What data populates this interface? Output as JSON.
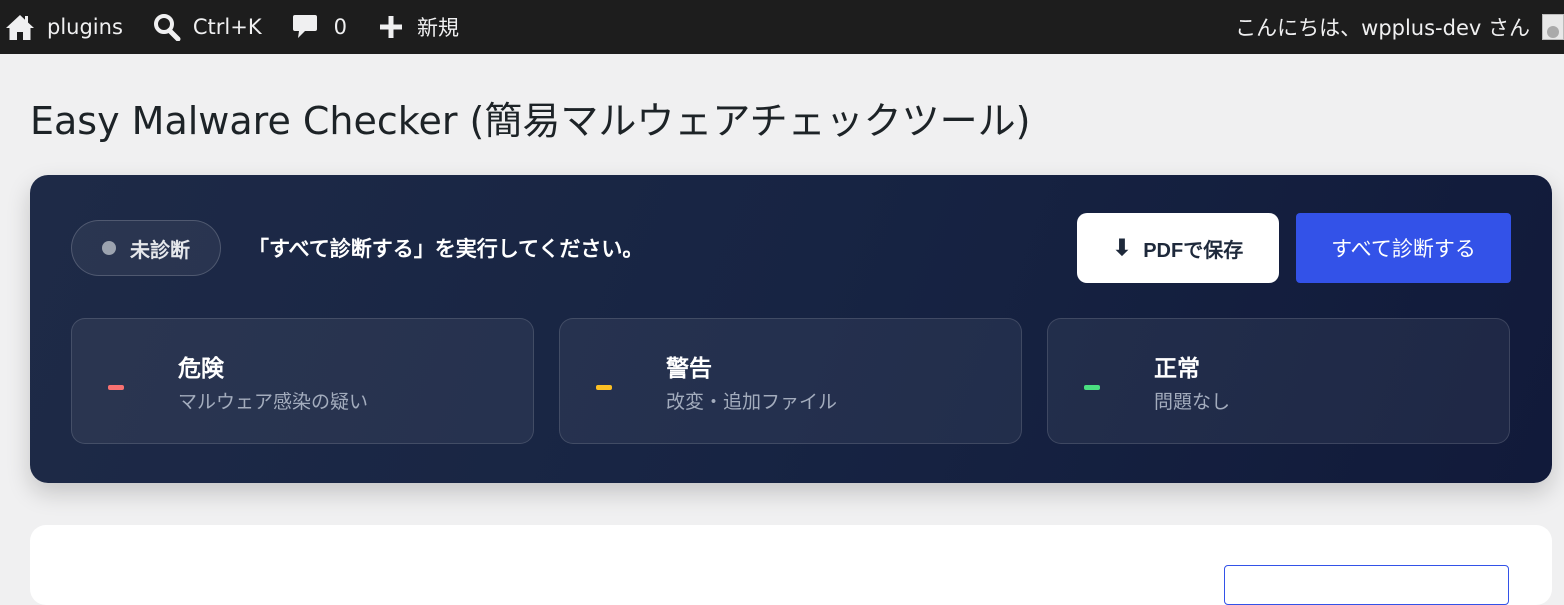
{
  "adminbar": {
    "site_name": "plugins",
    "search_shortcut": "Ctrl+K",
    "comments_count": "0",
    "new_label": "新規",
    "greeting": "こんにちは、wpplus-dev さん"
  },
  "page": {
    "title": "Easy Malware Checker (簡易マルウェアチェックツール)"
  },
  "panel": {
    "status_label": "未診断",
    "status_message": "「すべて診断する」を実行してください。",
    "pdf_button": "PDFで保存",
    "scan_button": "すべて診断する",
    "stats": [
      {
        "title": "危険",
        "description": "マルウェア感染の疑い",
        "color": "#f87171"
      },
      {
        "title": "警告",
        "description": "改変・追加ファイル",
        "color": "#fbbf24"
      },
      {
        "title": "正常",
        "description": "問題なし",
        "color": "#4ade80"
      }
    ]
  },
  "colors": {
    "panel_bg": "#172443",
    "primary": "#3352e8",
    "adminbar_bg": "#1d1d1d"
  }
}
